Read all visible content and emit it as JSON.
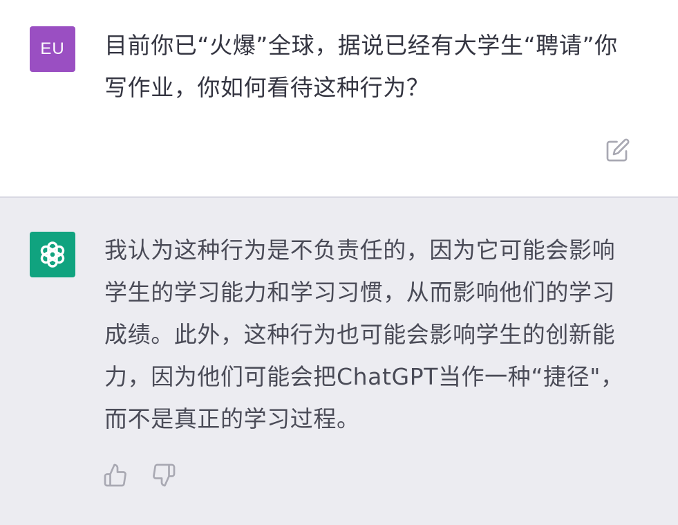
{
  "user_message": {
    "avatar_initials": "EU",
    "avatar_color": "#9a4fc2",
    "text": "目前你已“火爆”全球，据说已经有大学生“聘请”你写作业，你如何看待这种行为？",
    "edit_icon": "edit-icon"
  },
  "assistant_message": {
    "avatar_icon": "openai-logo-icon",
    "avatar_color": "#10a37f",
    "text": "我认为这种行为是不负责任的，因为它可能会影响学生的学习能力和学习习惯，从而影响他们的学习成绩。此外，这种行为也可能会影响学生的创新能力，因为他们可能会把ChatGPT当作一种“捷径\"，而不是真正的学习过程。",
    "feedback_icons": [
      "thumbs-up-icon",
      "thumbs-down-icon"
    ]
  },
  "colors": {
    "user_background": "#ffffff",
    "assistant_background": "#ececf1",
    "divider": "#d9d9e3",
    "icon_gray": "#a9a9b3"
  }
}
